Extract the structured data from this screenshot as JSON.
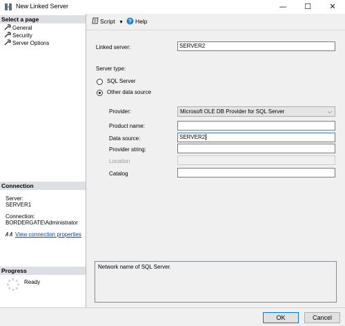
{
  "window": {
    "title": "New Linked Server",
    "minimize_glyph": "—",
    "maximize_glyph": "☐",
    "close_glyph": "✕"
  },
  "left": {
    "select_page_header": "Select a page",
    "pages": [
      "General",
      "Security",
      "Server Options"
    ],
    "connection_header": "Connection",
    "server_label": "Server:",
    "server_value": "SERVER1",
    "connection_label": "Connection:",
    "connection_value": "BORDERGATE\\Administrator",
    "view_link": "View connection properties",
    "progress_header": "Progress",
    "progress_status": "Ready"
  },
  "toolbar": {
    "script_label": "Script",
    "help_label": "Help"
  },
  "form": {
    "linked_server_label": "Linked server:",
    "linked_server_value": "SERVER2",
    "server_type_label": "Server type:",
    "sql_server_option": "SQL Server",
    "other_source_option": "Other data source",
    "selected_server_type": "Other data source",
    "provider_label": "Provider:",
    "provider_value": "Microsoft OLE DB Provider for SQL Server",
    "product_name_label": "Product name:",
    "product_name_value": "",
    "data_source_label": "Data source:",
    "data_source_value": "SERVER2",
    "provider_string_label": "Provider string:",
    "provider_string_value": "",
    "location_label": "Location",
    "location_value": "",
    "catalog_label": "Catalog",
    "catalog_value": ""
  },
  "description": "Network name of SQL Server.",
  "buttons": {
    "ok": "OK",
    "cancel": "Cancel"
  },
  "colors": {
    "accent": "#0078d7",
    "link": "#0645ad",
    "help_icon": "#1e7fd6",
    "section_header": "#dcdfe3"
  }
}
